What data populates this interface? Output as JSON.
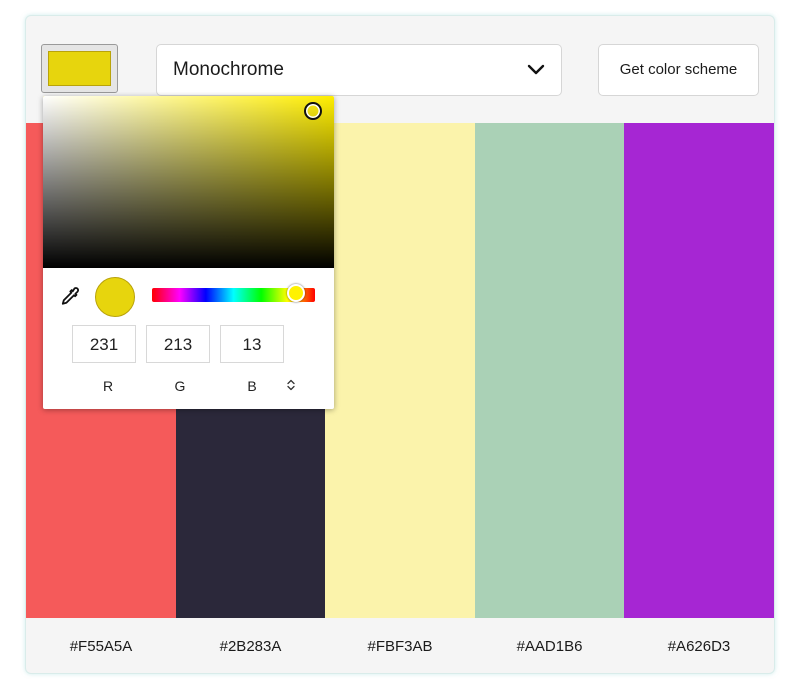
{
  "selected_color": "#E7D50D",
  "mode_select": {
    "value": "Monochrome"
  },
  "get_button": {
    "label": "Get color scheme"
  },
  "palette": [
    {
      "hex": "#F55A5A"
    },
    {
      "hex": "#2B283A"
    },
    {
      "hex": "#FBF3AB"
    },
    {
      "hex": "#AAD1B6"
    },
    {
      "hex": "#A626D3"
    }
  ],
  "picker": {
    "hue_color": "#FFEE00",
    "rgb": {
      "r": "231",
      "g": "213",
      "b": "13"
    },
    "labels": {
      "r": "R",
      "g": "G",
      "b": "B"
    }
  },
  "icons": [
    "chevron-down-icon",
    "eyedropper-icon",
    "format-toggle-icon"
  ]
}
